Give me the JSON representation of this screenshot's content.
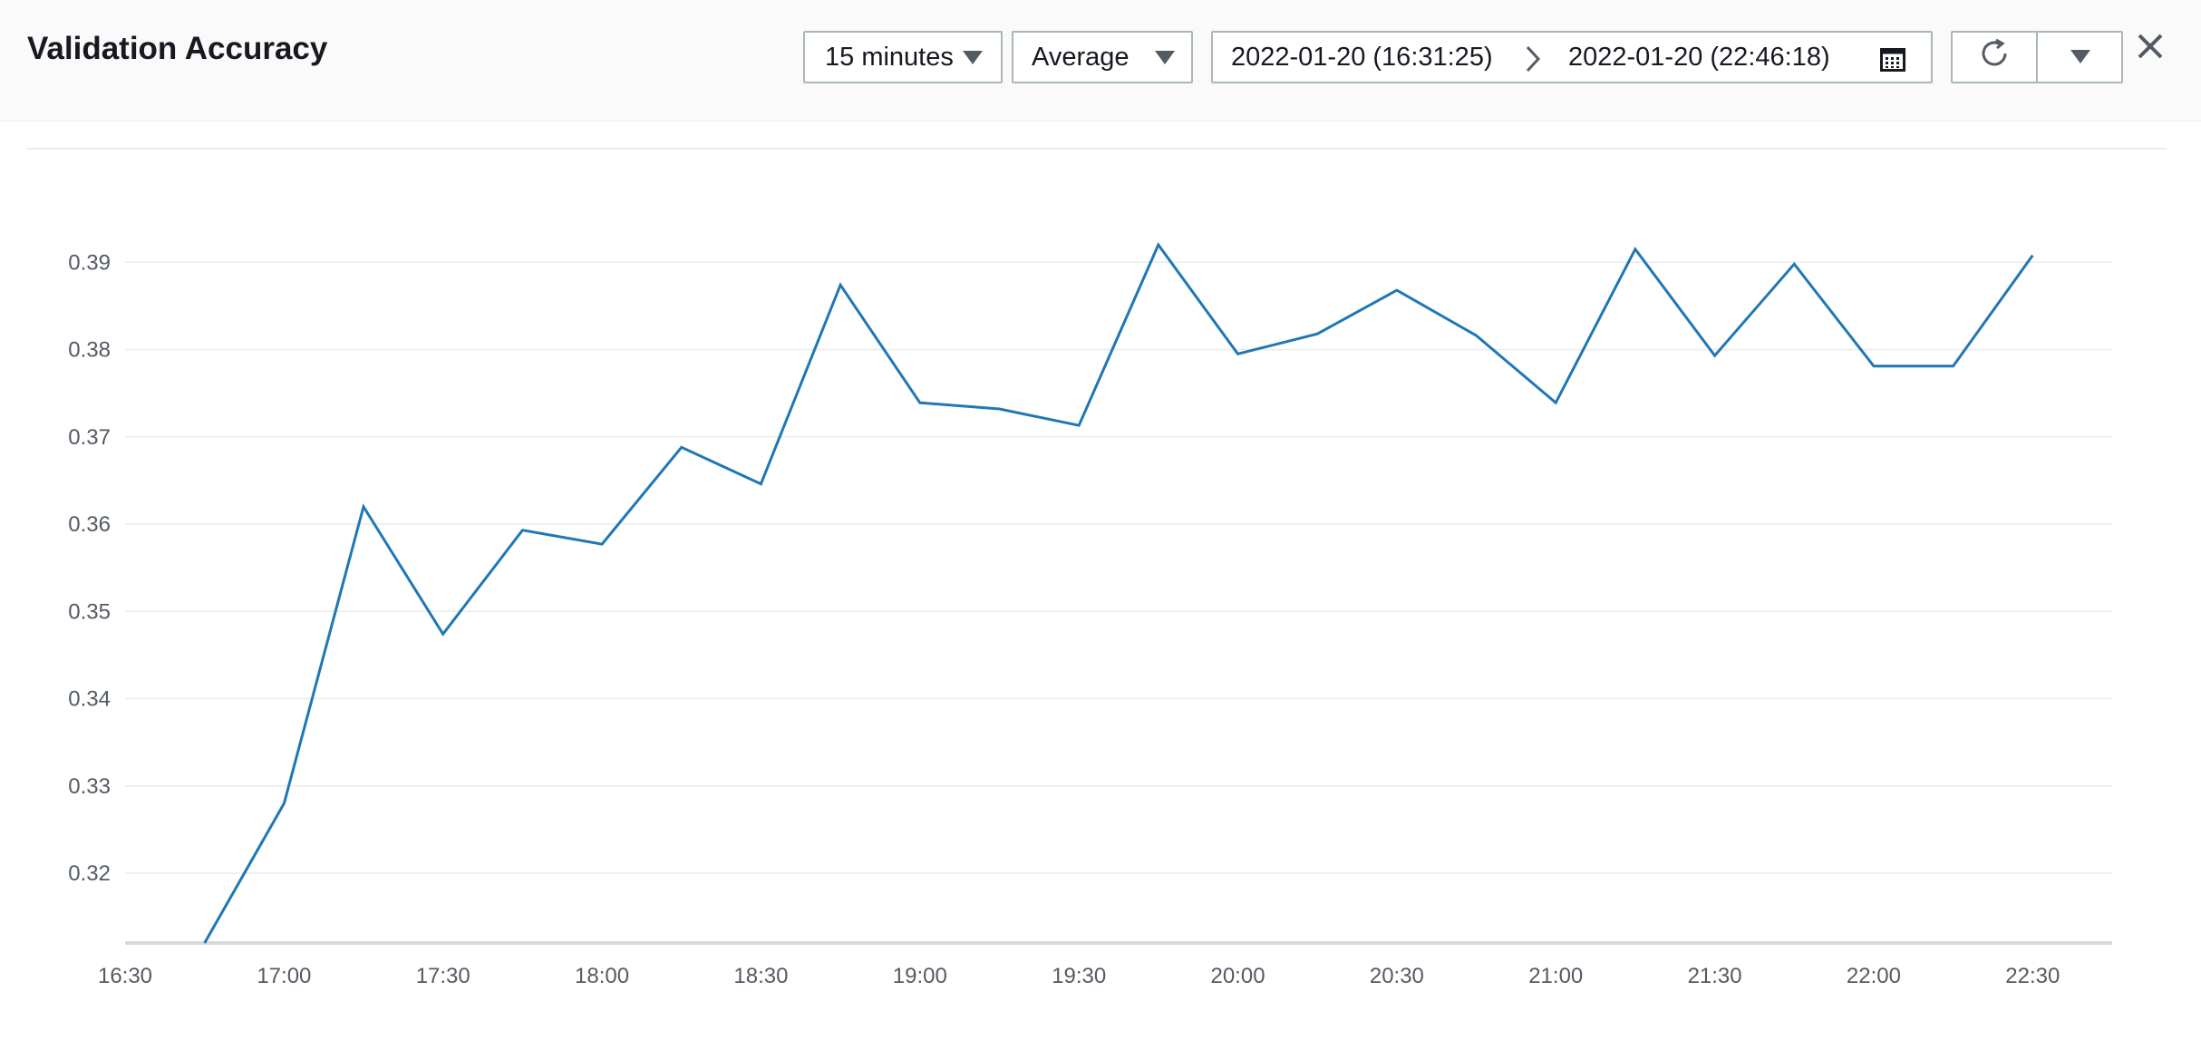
{
  "header": {
    "title": "Validation Accuracy",
    "period": "15 minutes",
    "statistic": "Average",
    "range_start": "2022-01-20 (16:31:25)",
    "range_end": "2022-01-20 (22:46:18)"
  },
  "icons": {
    "period_dropdown": "caret-down-icon",
    "stat_dropdown": "caret-down-icon",
    "range_separator": "chevron-right-icon",
    "calendar": "calendar-icon",
    "refresh": "refresh-icon",
    "more": "caret-down-icon",
    "close": "close-icon"
  },
  "colors": {
    "series": "#1f77b4",
    "grid": "#e9ebed",
    "axis": "#d5dbdb"
  },
  "chart_data": {
    "type": "line",
    "title": "Validation Accuracy",
    "xlabel": "",
    "ylabel": "",
    "grid": true,
    "legend": "none",
    "ylim": [
      0.312,
      0.392
    ],
    "xlim": [
      "16:30",
      "22:45"
    ],
    "y_ticks": [
      "0.32",
      "0.33",
      "0.34",
      "0.35",
      "0.36",
      "0.37",
      "0.38",
      "0.39"
    ],
    "x_ticks": [
      "16:30",
      "17:00",
      "17:30",
      "18:00",
      "18:30",
      "19:00",
      "19:30",
      "20:00",
      "20:30",
      "21:00",
      "21:30",
      "22:00",
      "22:30"
    ],
    "series": [
      {
        "x": [
          "16:45",
          "17:00",
          "17:15",
          "17:30",
          "17:45",
          "18:00",
          "18:15",
          "18:30",
          "18:45",
          "19:00",
          "19:15",
          "19:30",
          "19:45",
          "20:00",
          "20:15",
          "20:30",
          "20:45",
          "21:00",
          "21:15",
          "21:30",
          "21:45",
          "22:00",
          "22:15",
          "22:30"
        ],
        "values": [
          0.312,
          0.328,
          0.362,
          0.3474,
          0.3593,
          0.3577,
          0.3688,
          0.3646,
          0.3874,
          0.3739,
          0.3732,
          0.3713,
          0.392,
          0.3795,
          0.3818,
          0.3868,
          0.3816,
          0.3739,
          0.3915,
          0.3793,
          0.3898,
          0.3781,
          0.3781,
          0.3908
        ]
      }
    ]
  }
}
